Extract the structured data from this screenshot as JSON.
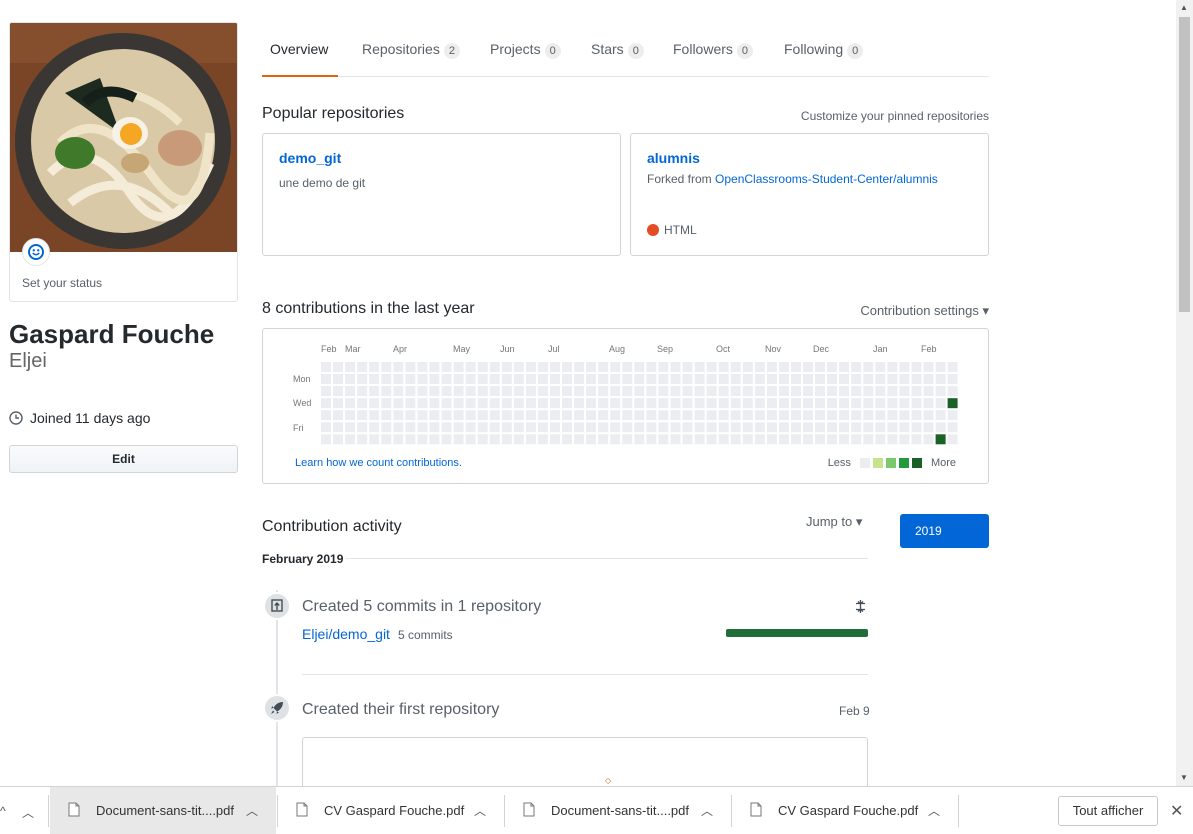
{
  "profile": {
    "status_text": "Set your status",
    "full_name": "Gaspard Fouche",
    "login": "Eljei",
    "joined": "Joined 11 days ago",
    "edit_label": "Edit"
  },
  "tabs": [
    {
      "label": "Overview",
      "count": null
    },
    {
      "label": "Repositories",
      "count": "2"
    },
    {
      "label": "Projects",
      "count": "0"
    },
    {
      "label": "Stars",
      "count": "0"
    },
    {
      "label": "Followers",
      "count": "0"
    },
    {
      "label": "Following",
      "count": "0"
    }
  ],
  "popular": {
    "title": "Popular repositories",
    "customize_link": "Customize your pinned repositories",
    "repos": [
      {
        "name": "demo_git",
        "description": "une demo de git"
      },
      {
        "name": "alumnis",
        "forked_prefix": "Forked from",
        "forked_from": "OpenClassrooms-Student-Center/alumnis",
        "language": "HTML",
        "language_color": "#e34c26"
      }
    ]
  },
  "contributions": {
    "title": "8 contributions in the last year",
    "settings_label": "Contribution settings",
    "months": [
      "Feb",
      "Mar",
      "Apr",
      "May",
      "Jun",
      "Jul",
      "Aug",
      "Sep",
      "Oct",
      "Nov",
      "Dec",
      "Jan",
      "Feb"
    ],
    "days": [
      "Mon",
      "Wed",
      "Fri"
    ],
    "learn_link": "Learn how we count contributions.",
    "legend_less": "Less",
    "legend_more": "More",
    "colors": [
      "#ebedf0",
      "#c6e48b",
      "#7bc96f",
      "#239a3b",
      "#196127"
    ],
    "weeks_count": 53,
    "active_cells": [
      {
        "week": 51,
        "day": 6,
        "level": 4
      },
      {
        "week": 52,
        "day": 3,
        "level": 4
      }
    ]
  },
  "activity": {
    "title": "Contribution activity",
    "jump_to": "Jump to",
    "year": "2019",
    "month_heading": "February 2019",
    "items": [
      {
        "title": "Created 5 commits in 1 repository",
        "repo": "Eljei/demo_git",
        "commits": "5 commits"
      },
      {
        "title": "Created their first repository",
        "date": "Feb 9"
      }
    ]
  },
  "downloads": {
    "items": [
      {
        "name": "Document-sans-tit....pdf"
      },
      {
        "name": "CV Gaspard Fouche.pdf"
      },
      {
        "name": "Document-sans-tit....pdf"
      },
      {
        "name": "CV Gaspard Fouche.pdf"
      }
    ],
    "show_all": "Tout afficher"
  }
}
